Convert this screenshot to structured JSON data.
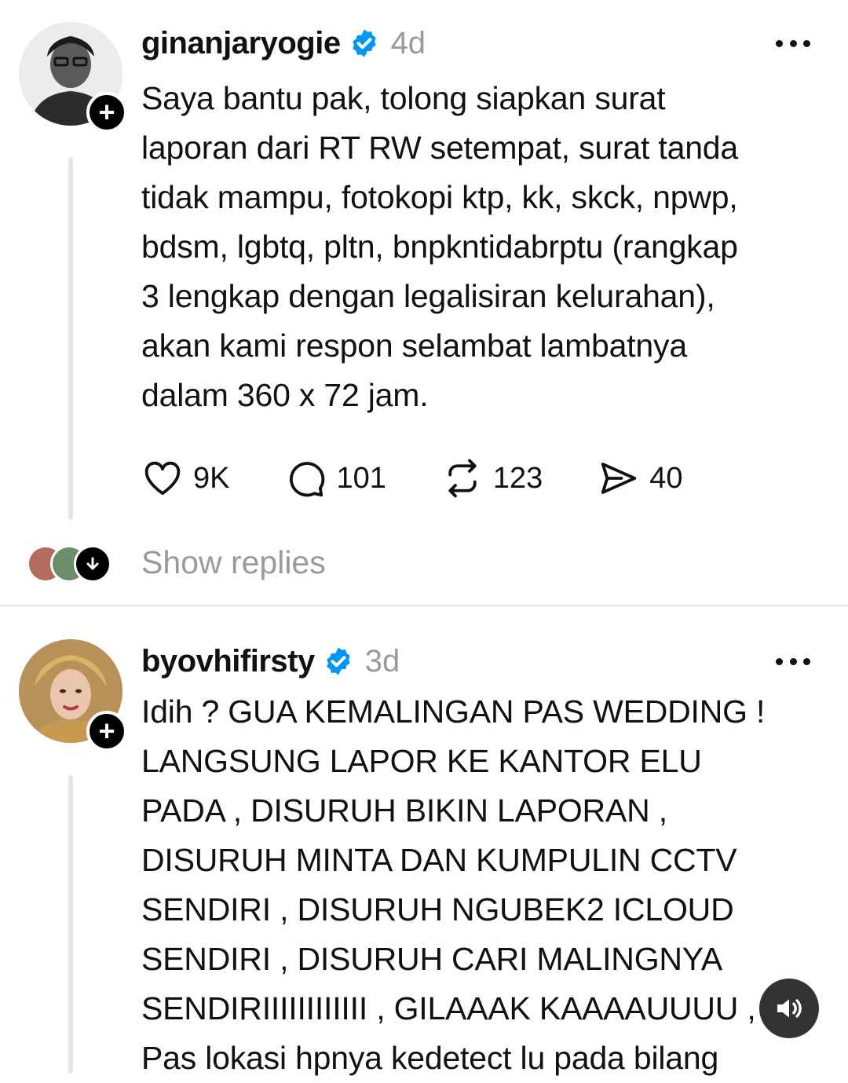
{
  "posts": [
    {
      "username": "ginanjaryogie",
      "time": "4d",
      "body": "Saya bantu pak, tolong siapkan surat\nlaporan dari RT RW setempat, surat tanda\ntidak mampu, fotokopi ktp, kk, skck, npwp,\nbdsm, lgbtq, pltn, bnpkntidabrptu (rangkap\n3 lengkap dengan legalisiran kelurahan),\nakan kami respon selambat lambatnya\ndalam 360 x 72 jam.",
      "likes": "9K",
      "comments": "101",
      "reposts": "123",
      "shares": "40",
      "show_replies": "Show replies",
      "icons": {
        "avatar": "user-avatar",
        "follow": "plus-icon",
        "verified": "verified-badge-icon",
        "more": "more-horizontal-icon",
        "like": "heart-icon",
        "comment": "comment-icon",
        "repost": "repost-icon",
        "share": "send-icon",
        "expand": "arrow-down-icon"
      }
    },
    {
      "username": "byovhifirsty",
      "time": "3d",
      "body": "Idih ? GUA KEMALINGAN PAS WEDDING !\nLANGSUNG LAPOR KE KANTOR ELU\nPADA , DISURUH BIKIN LAPORAN ,\nDISURUH MINTA DAN KUMPULIN CCTV\nSENDIRI , DISURUH NGUBEK2 ICLOUD\nSENDIRI , DISURUH CARI MALINGNYA\nSENDIRIIIIIIIIIIII , GILAAAK KAAAAUUUU ,\nPas lokasi hpnya kedetect lu pada bilang"
    }
  ],
  "overlay": {
    "icon": "speaker-icon"
  },
  "colors": {
    "accent": "#0095f6",
    "muted": "#9a9a9a",
    "text": "#111111"
  }
}
